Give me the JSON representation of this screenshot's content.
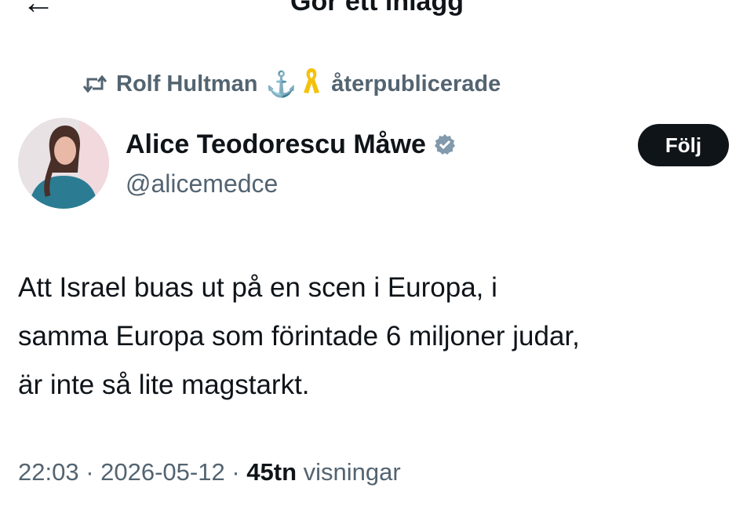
{
  "header": {
    "title": "Gör ett inlägg",
    "back_icon": "back-arrow-icon",
    "more_icon": "more-dots-icon"
  },
  "repost": {
    "icon": "repost-icon",
    "name": "Rolf Hultman",
    "emoji_anchor": "⚓",
    "emoji_ribbon": "yellow-ribbon-icon",
    "action": "återpublicerade"
  },
  "author": {
    "display_name": "Alice Teodorescu Måwe",
    "handle": "@alicemedce",
    "verified_icon": "verified-badge-icon",
    "verified_color": "#829aab"
  },
  "follow_button": {
    "label": "Följ"
  },
  "tweet": {
    "lines": [
      "Att Israel buas ut på en scen i Europa, i",
      "samma Europa som förintade 6 miljoner judar,",
      "är inte så lite magstarkt."
    ]
  },
  "meta": {
    "time": "22:03",
    "sep1": " · ",
    "date": "2026-05-12",
    "sep2": " · ",
    "views_count": "45tn",
    "views_label": " visningar"
  },
  "colors": {
    "text": "#0f1419",
    "secondary": "#536471",
    "button_bg": "#0f1419",
    "ribbon": "#f4c20d"
  }
}
